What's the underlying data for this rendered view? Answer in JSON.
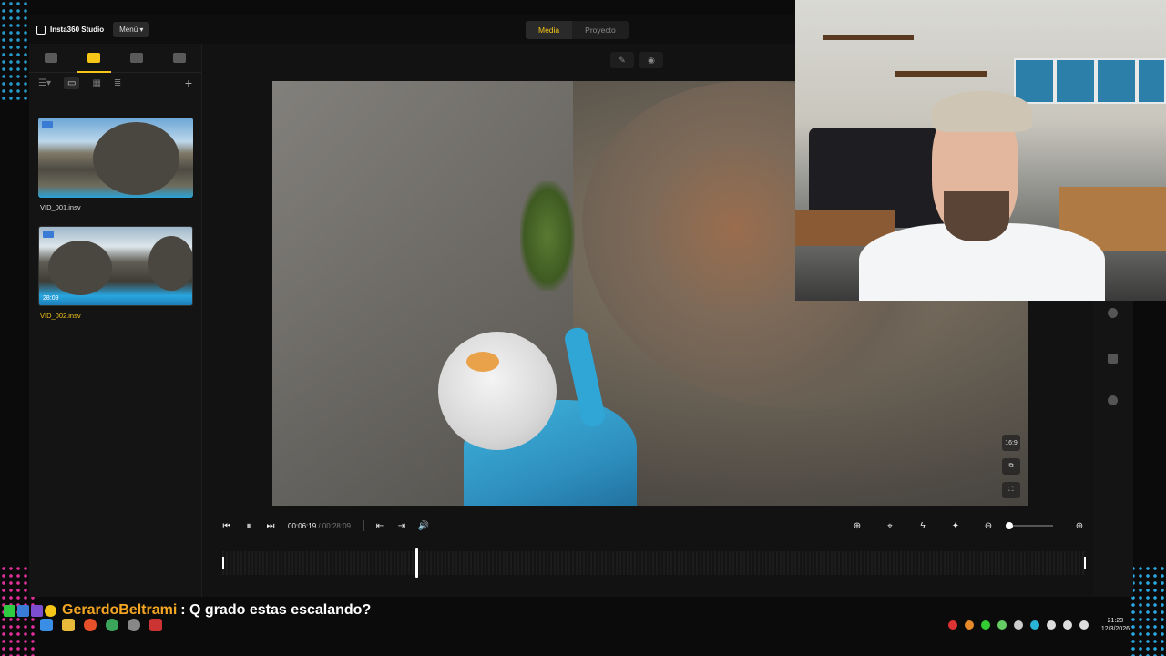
{
  "app": {
    "title": "Insta360 Studio",
    "menu_label": "Menú"
  },
  "tabs": [
    {
      "label": "Media",
      "active": true
    },
    {
      "label": "Proyecto",
      "active": false
    }
  ],
  "files": [
    {
      "name": "VID_001.insv",
      "selected": false,
      "duration": ""
    },
    {
      "name": "VID_002.insv",
      "selected": true,
      "duration": "28:09"
    }
  ],
  "video": {
    "aspect_label": "16:9"
  },
  "player": {
    "current_time": "00:06:19",
    "total_time": "/ 00:28:09",
    "playhead_fraction": 0.224
  },
  "chat": {
    "username": "GerardoBeltrami",
    "message": ": Q grado estas escalando?"
  },
  "clock": {
    "time": "21:23",
    "date": "12/3/2026"
  },
  "colors": {
    "accent": "#f5c518",
    "chat_user": "#f5a623"
  },
  "icons": {
    "play_prev": "⏮",
    "pause": "⏸",
    "play_next": "⏭",
    "volume": "🔊",
    "zoom_out": "⊖",
    "zoom_in": "⊕",
    "add": "+"
  }
}
